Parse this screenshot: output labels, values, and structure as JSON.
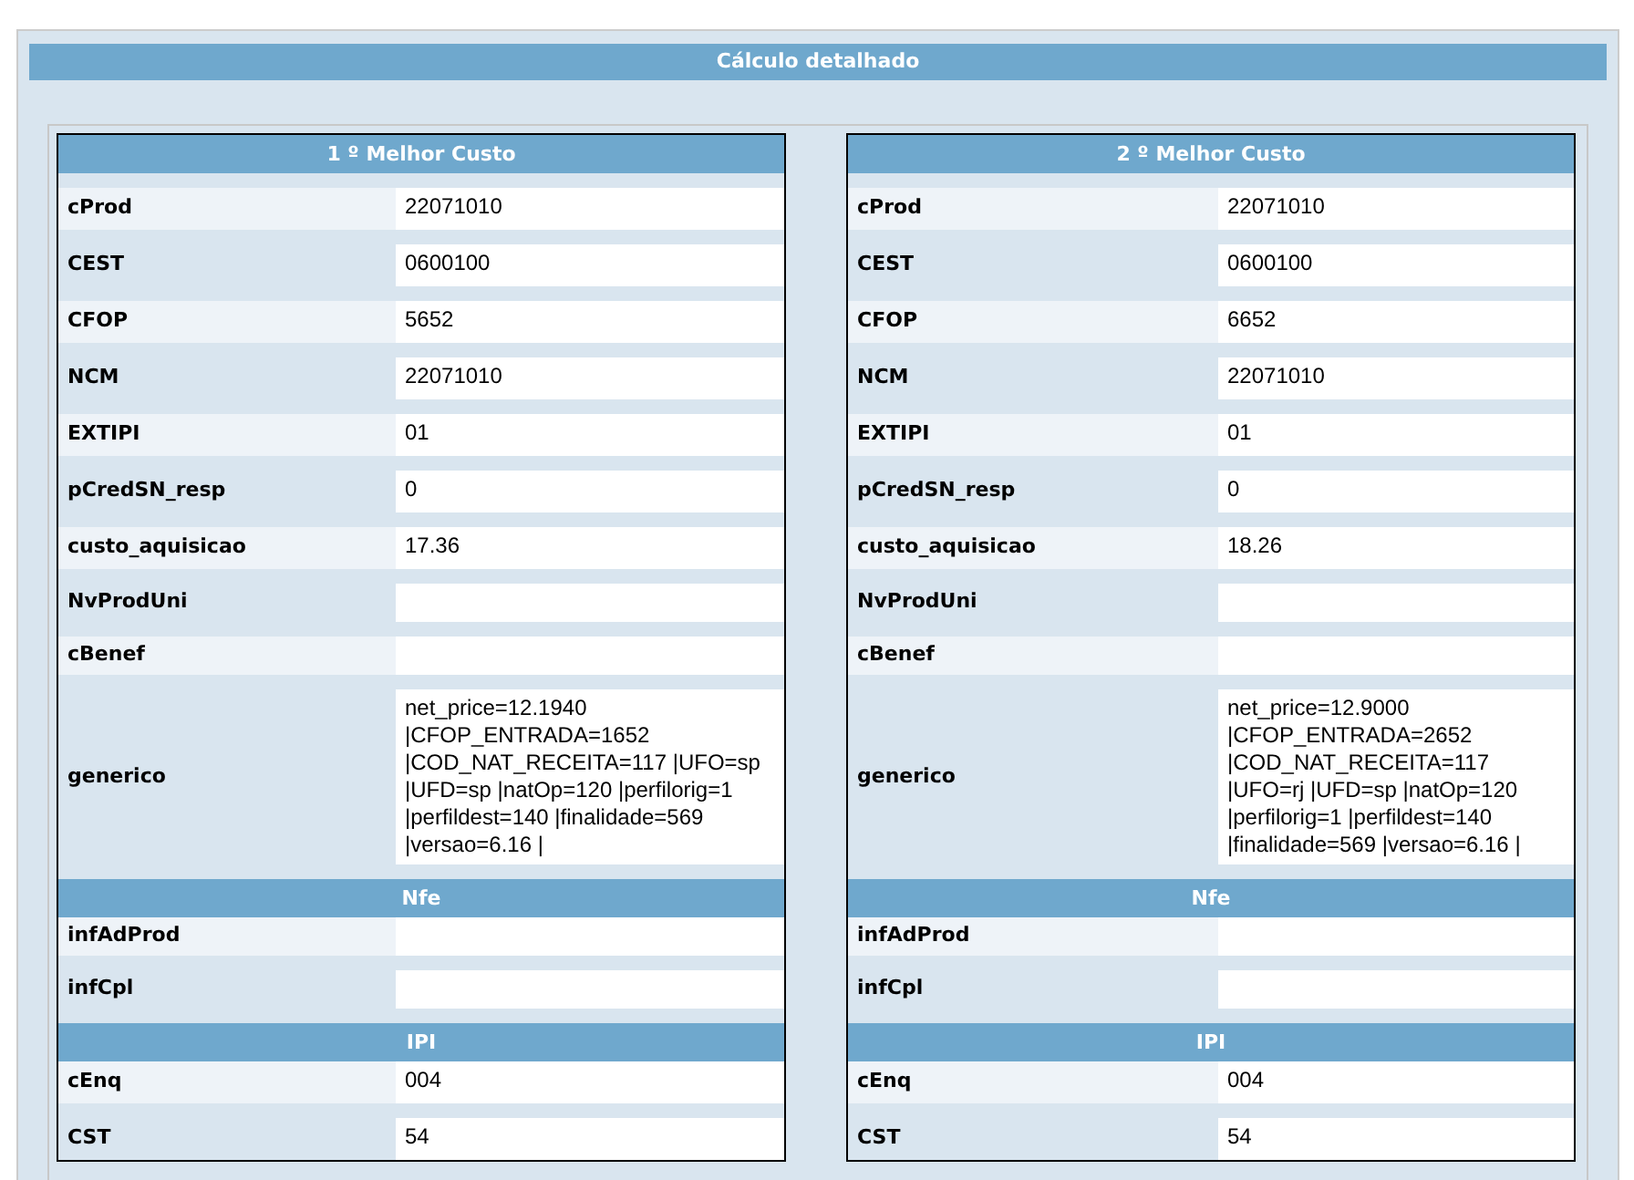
{
  "title": "Cálculo detalhado",
  "cards": [
    {
      "title": "1 º Melhor Custo",
      "rows": [
        {
          "kind": "field",
          "label": "cProd",
          "value": "22071010"
        },
        {
          "kind": "field",
          "label": "CEST",
          "value": "0600100"
        },
        {
          "kind": "field",
          "label": "CFOP",
          "value": "5652"
        },
        {
          "kind": "field",
          "label": "NCM",
          "value": "22071010"
        },
        {
          "kind": "field",
          "label": "EXTIPI",
          "value": "01"
        },
        {
          "kind": "field",
          "label": "pCredSN_resp",
          "value": "0"
        },
        {
          "kind": "field",
          "label": "custo_aquisicao",
          "value": "17.36"
        },
        {
          "kind": "field",
          "label": "NvProdUni"
        },
        {
          "kind": "field",
          "label": "cBenef"
        },
        {
          "kind": "field",
          "label": "generico",
          "value": "net_price=12.1940 |CFOP_ENTRADA=1652 |COD_NAT_RECEITA=117 |UFO=sp |UFD=sp |natOp=120 |perfilorig=1 |perfildest=140 |finalidade=569 |versao=6.16 |"
        },
        {
          "kind": "section",
          "label": "Nfe"
        },
        {
          "kind": "field",
          "label": "infAdProd"
        },
        {
          "kind": "field",
          "label": "infCpl"
        },
        {
          "kind": "section",
          "label": "IPI"
        },
        {
          "kind": "field",
          "label": "cEnq",
          "value": "004"
        },
        {
          "kind": "field",
          "label": "CST",
          "value": "54"
        }
      ]
    },
    {
      "title": "2 º Melhor Custo",
      "rows": [
        {
          "kind": "field",
          "label": "cProd",
          "value": "22071010"
        },
        {
          "kind": "field",
          "label": "CEST",
          "value": "0600100"
        },
        {
          "kind": "field",
          "label": "CFOP",
          "value": "6652"
        },
        {
          "kind": "field",
          "label": "NCM",
          "value": "22071010"
        },
        {
          "kind": "field",
          "label": "EXTIPI",
          "value": "01"
        },
        {
          "kind": "field",
          "label": "pCredSN_resp",
          "value": "0"
        },
        {
          "kind": "field",
          "label": "custo_aquisicao",
          "value": "18.26"
        },
        {
          "kind": "field",
          "label": "NvProdUni"
        },
        {
          "kind": "field",
          "label": "cBenef"
        },
        {
          "kind": "field",
          "label": "generico",
          "value": "net_price=12.9000 |CFOP_ENTRADA=2652 |COD_NAT_RECEITA=117 |UFO=rj |UFD=sp |natOp=120 |perfilorig=1 |perfildest=140 |finalidade=569 |versao=6.16 |"
        },
        {
          "kind": "section",
          "label": "Nfe"
        },
        {
          "kind": "field",
          "label": "infAdProd"
        },
        {
          "kind": "field",
          "label": "infCpl"
        },
        {
          "kind": "section",
          "label": "IPI"
        },
        {
          "kind": "field",
          "label": "cEnq",
          "value": "004"
        },
        {
          "kind": "field",
          "label": "CST",
          "value": "54"
        }
      ]
    }
  ]
}
